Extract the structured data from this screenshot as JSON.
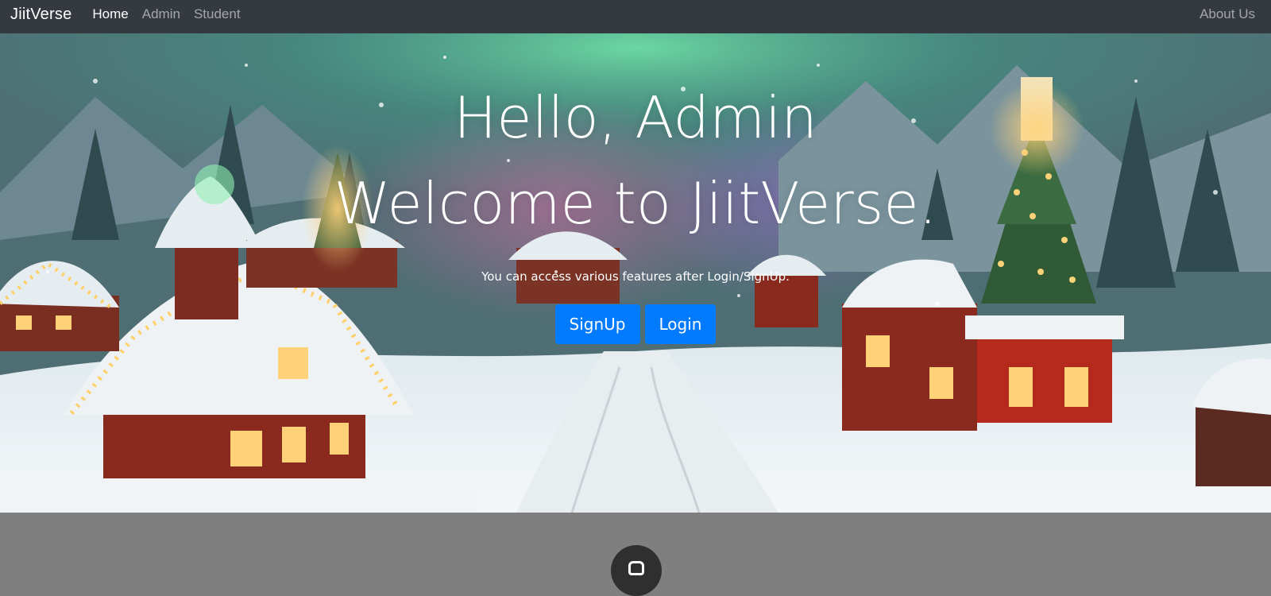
{
  "navbar": {
    "brand": "JiitVerse",
    "links": [
      {
        "label": "Home",
        "active": true
      },
      {
        "label": "Admin",
        "active": false
      },
      {
        "label": "Student",
        "active": false
      }
    ],
    "right_link": "About Us"
  },
  "hero": {
    "greeting": "Hello, Admin",
    "welcome": "Welcome to JiitVerse.",
    "lead": "You can access various features after Login/SignUp.",
    "signup_label": "SignUp",
    "login_label": "Login",
    "background": "snowy-christmas-village-illustration"
  },
  "colors": {
    "navbar_bg": "#343a40",
    "button_primary": "#007bff",
    "footer_band": "#7f7f7f"
  },
  "icons": {
    "bottom_circle": "user-icon"
  }
}
